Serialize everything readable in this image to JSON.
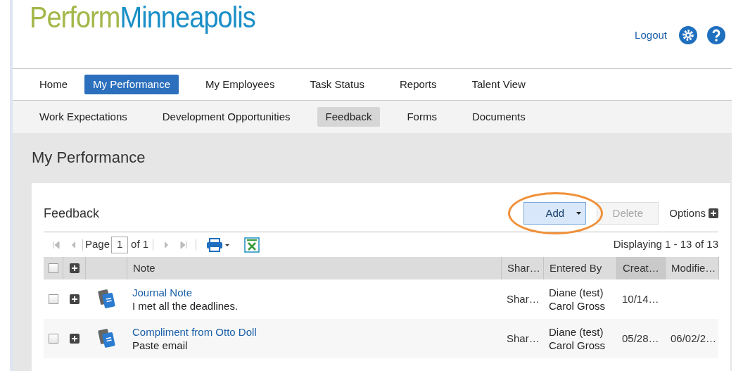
{
  "logo": {
    "part_1": "Perform",
    "part_2": "Minneapolis"
  },
  "header": {
    "logout": "Logout"
  },
  "nav": [
    {
      "label": "Home",
      "selected": false
    },
    {
      "label": "My Performance",
      "selected": true
    },
    {
      "label": "My Employees",
      "selected": false
    },
    {
      "label": "Task Status",
      "selected": false
    },
    {
      "label": "Reports",
      "selected": false
    },
    {
      "label": "Talent View",
      "selected": false
    }
  ],
  "subnav": [
    {
      "label": "Work Expectations",
      "selected": false
    },
    {
      "label": "Development Opportunities",
      "selected": false
    },
    {
      "label": "Feedback",
      "selected": true
    },
    {
      "label": "Forms",
      "selected": false
    },
    {
      "label": "Documents",
      "selected": false
    }
  ],
  "page_title": "My Performance",
  "panel": {
    "title": "Feedback",
    "add": "Add",
    "delete": "Delete",
    "delete_disabled": true,
    "options": "Options",
    "highlight_add": true
  },
  "pager": {
    "page_label": "Page",
    "page": "1",
    "of": "of 1",
    "displaying": "Displaying 1 - 13 of 13"
  },
  "table": {
    "all_checked": false,
    "columns": [
      "Note",
      "Shar…",
      "Entered By",
      "Creat…",
      "Modifie…"
    ],
    "rows": [
      {
        "checked": false,
        "title": "Journal Note",
        "text": "I met all the deadlines.",
        "shared": "Shar…",
        "entered_by": [
          "Diane (test)",
          "Carol Gross"
        ],
        "created": "10/14…"
      },
      {
        "checked": false,
        "title": "Compliment from Otto Doll",
        "text": "Paste email",
        "shared": "Shar…",
        "entered_by": [
          "Diane (test)",
          "Carol Gross"
        ],
        "created": "05/28…",
        "modified": "06/02/2…"
      }
    ]
  }
}
